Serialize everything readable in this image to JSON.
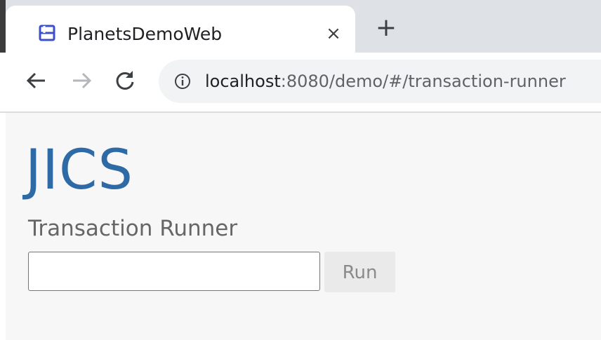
{
  "browser": {
    "tab": {
      "title": "PlanetsDemoWeb",
      "favicon": "app-favicon-icon",
      "close_glyph": "×"
    },
    "new_tab_glyph": "+",
    "nav": {
      "back_icon": "back-arrow-icon",
      "forward_icon": "forward-arrow-icon",
      "reload_icon": "reload-icon"
    },
    "address": {
      "host": "localhost",
      "rest": ":8080/demo/#/transaction-runner",
      "info_icon": "info-icon"
    }
  },
  "page": {
    "app_title": "JICS",
    "section_title": "Transaction Runner",
    "transaction_input": {
      "value": "",
      "placeholder": ""
    },
    "run_button_label": "Run"
  },
  "colors": {
    "accent": "#2e6aa6",
    "page_background": "#f7f7f7",
    "tabstrip_background": "#dee1e6",
    "favicon": "#3b50c8"
  }
}
